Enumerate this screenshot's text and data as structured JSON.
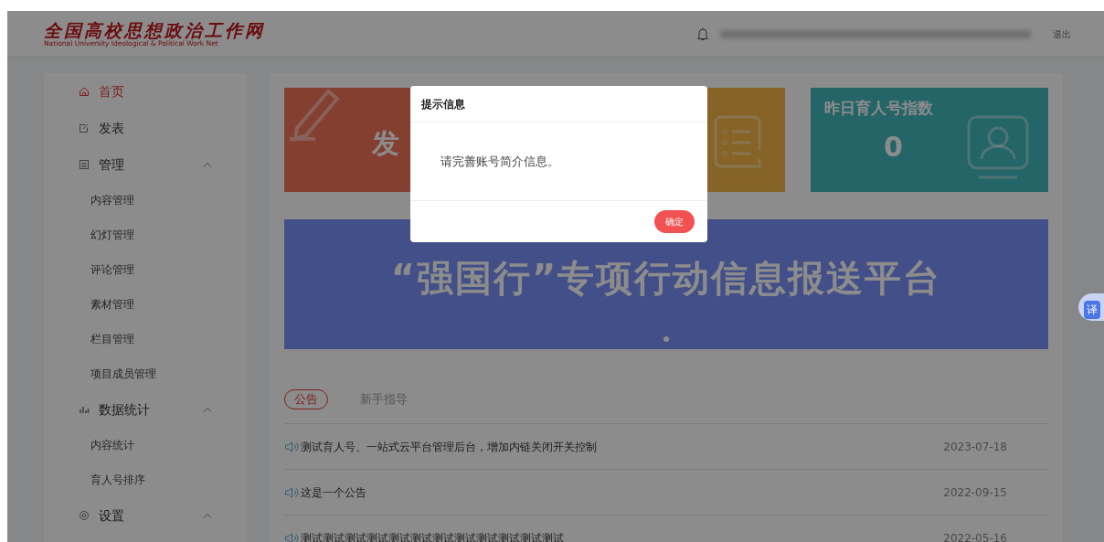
{
  "header": {
    "logo_title": "全国高校思想政治工作网",
    "logo_subtitle": "National University Ideological & Political Work Net",
    "logout": "退出"
  },
  "sidebar": {
    "items": [
      {
        "label": "首页",
        "selected": true
      },
      {
        "label": "发表",
        "selected": false
      },
      {
        "label": "管理",
        "selected": false,
        "expanded": true,
        "children": [
          {
            "label": "内容管理",
            "selected": false
          },
          {
            "label": "幻灯管理",
            "selected": false
          },
          {
            "label": "评论管理",
            "selected": false
          },
          {
            "label": "素材管理",
            "selected": false
          },
          {
            "label": "栏目管理",
            "selected": false
          },
          {
            "label": "项目成员管理",
            "selected": false
          }
        ]
      },
      {
        "label": "数据统计",
        "selected": false,
        "expanded": true,
        "children": [
          {
            "label": "内容统计",
            "selected": false
          },
          {
            "label": "育人号排序",
            "selected": false
          }
        ]
      },
      {
        "label": "设置",
        "selected": false,
        "expanded": true
      }
    ]
  },
  "cards": [
    {
      "kind": "publish",
      "title": "发"
    },
    {
      "kind": "list"
    },
    {
      "kind": "index",
      "title": "昨日育人号指数",
      "value": "0"
    }
  ],
  "banner": {
    "title": "“强国行”专项行动信息报送平台"
  },
  "notice_tabs": [
    {
      "label": "公告",
      "selected": true
    },
    {
      "label": "新手指导",
      "selected": false
    }
  ],
  "notices": [
    {
      "text": "测试育人号、一站式云平台管理后台，增加内链关闭开关控制",
      "date": "2023-07-18"
    },
    {
      "text": "这是一个公告",
      "date": "2022-09-15"
    },
    {
      "text": "测试测试测试测试测试测试测试测试测试测试测试测试",
      "date": "2022-05-16"
    }
  ],
  "modal": {
    "title": "提示信息",
    "message": "请完善账号简介信息。",
    "confirm": "确定"
  },
  "translate_button": "译"
}
